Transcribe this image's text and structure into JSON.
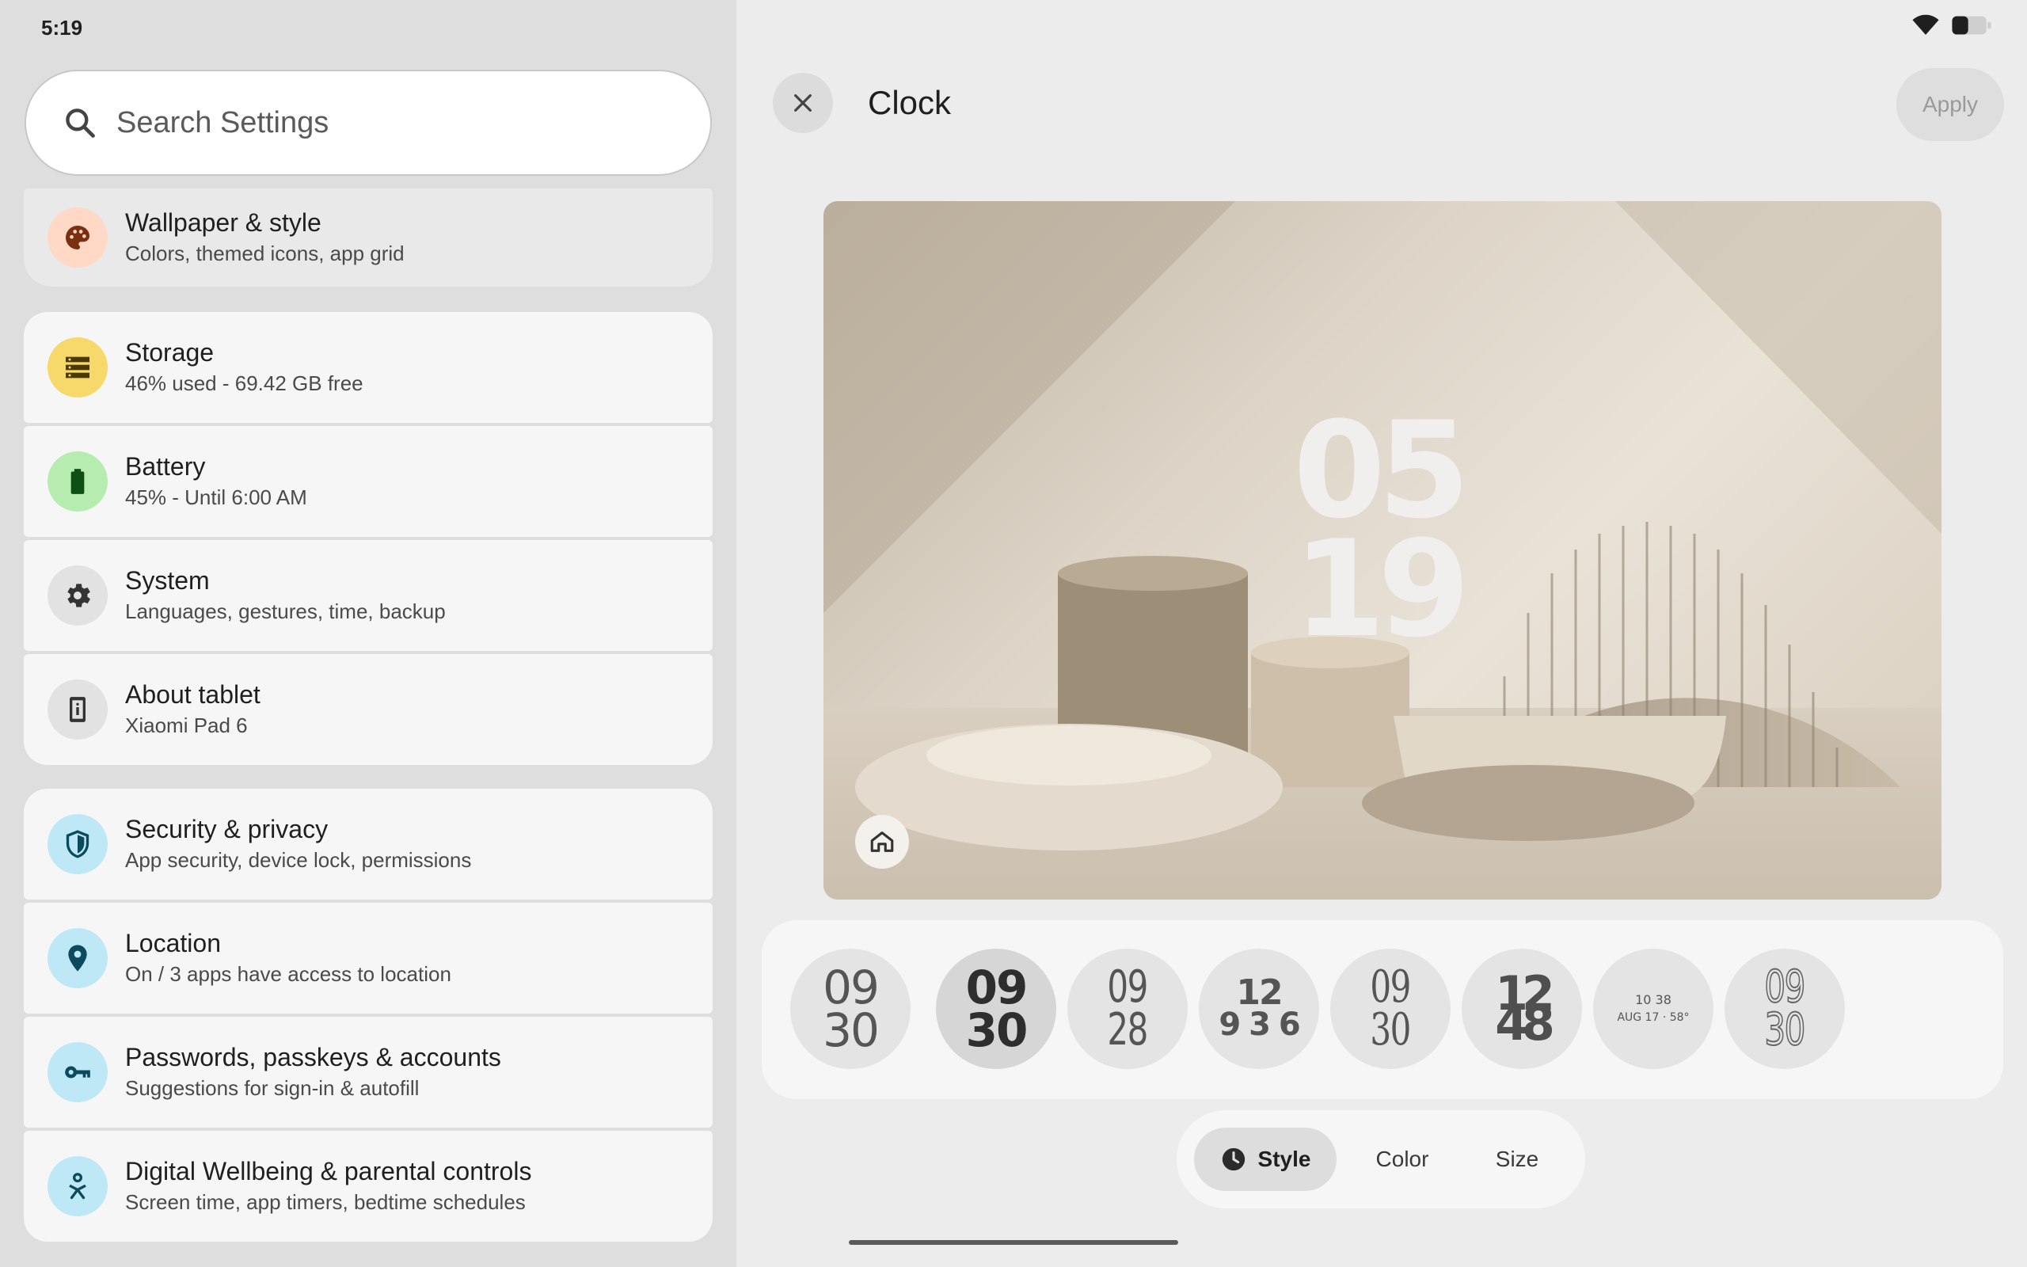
{
  "status_bar": {
    "time": "5:19",
    "wifi_icon": "wifi-icon",
    "battery_icon": "battery-icon"
  },
  "settings": {
    "search": {
      "placeholder": "Search Settings"
    },
    "items": [
      {
        "title": "Wallpaper & style",
        "subtitle": "Colors, themed icons, app grid",
        "icon": "palette-icon",
        "icon_bg": "#ffd8c6",
        "icon_color": "#7a2f10"
      },
      {
        "title": "Storage",
        "subtitle": "46% used - 69.42 GB free",
        "icon": "storage-icon",
        "icon_bg": "#f7d86a",
        "icon_color": "#4a3a00"
      },
      {
        "title": "Battery",
        "subtitle": "45% - Until 6:00 AM",
        "icon": "battery-icon",
        "icon_bg": "#b7ecb0",
        "icon_color": "#0e4f16"
      },
      {
        "title": "System",
        "subtitle": "Languages, gestures, time, backup",
        "icon": "gear-icon",
        "icon_bg": "#e2e2e2",
        "icon_color": "#333333"
      },
      {
        "title": "About tablet",
        "subtitle": "Xiaomi Pad 6",
        "icon": "tablet-info-icon",
        "icon_bg": "#e2e2e2",
        "icon_color": "#333333"
      },
      {
        "title": "Security & privacy",
        "subtitle": "App security, device lock, permissions",
        "icon": "shield-icon",
        "icon_bg": "#bfe8f6",
        "icon_color": "#0b4b5e"
      },
      {
        "title": "Location",
        "subtitle": "On / 3 apps have access to location",
        "icon": "location-pin-icon",
        "icon_bg": "#bfe8f6",
        "icon_color": "#0b4b5e"
      },
      {
        "title": "Passwords, passkeys & accounts",
        "subtitle": "Suggestions for sign-in & autofill",
        "icon": "key-icon",
        "icon_bg": "#bfe8f6",
        "icon_color": "#0b4b5e"
      },
      {
        "title": "Digital Wellbeing & parental controls",
        "subtitle": "Screen time, app timers, bedtime schedules",
        "icon": "wellbeing-icon",
        "icon_bg": "#bfe8f6",
        "icon_color": "#0b4b5e"
      }
    ]
  },
  "clock_editor": {
    "title": "Clock",
    "close_icon": "close-icon",
    "apply_label": "Apply",
    "preview_time": {
      "hours": "05",
      "minutes": "19"
    },
    "home_icon": "home-icon",
    "faces": [
      {
        "line1": "09",
        "line2": "30"
      },
      {
        "line1": "09",
        "line2": "30"
      },
      {
        "line1": "09",
        "line2": "28"
      },
      {
        "line1": "12",
        "line2": "9 3 6"
      },
      {
        "line1": "09",
        "line2": "30"
      },
      {
        "line1": "12",
        "line2": "48"
      },
      {
        "line1": "10 38",
        "line2": "AUG 17 · 58°"
      },
      {
        "line1": "09",
        "line2": "30"
      }
    ],
    "tabs": [
      {
        "label": "Style",
        "icon": "clock-icon",
        "active": true
      },
      {
        "label": "Color",
        "active": false
      },
      {
        "label": "Size",
        "active": false
      }
    ]
  }
}
